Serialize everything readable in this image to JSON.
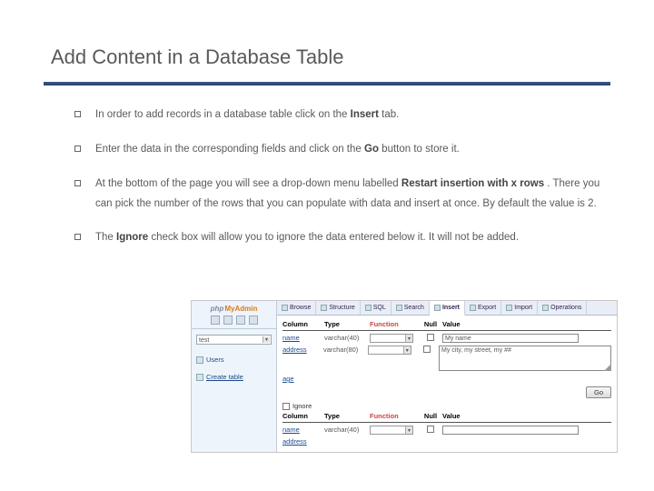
{
  "title": "Add Content in a Database Table",
  "bullets": {
    "b1_a": "In order to add records in a database table click on the ",
    "b1_s": "Insert",
    "b1_b": " tab.",
    "b2_a": "Enter the data in the corresponding fields and click on the ",
    "b2_s": "Go",
    "b2_b": " button to store it.",
    "b3_a": "At the bottom of the page you will see a drop-down menu labelled ",
    "b3_s": "Restart insertion with x rows",
    "b3_b": " . There you can pick the number of the rows that you can populate with data and insert at once. By default the value is 2.",
    "b4_a": "The ",
    "b4_s": "Ignore",
    "b4_b": " check box will allow you to ignore the data entered below it. It will not be added."
  },
  "pma": {
    "logo_php": "php",
    "logo_ma": "MyAdmin",
    "select_text": "test",
    "tree_item": "Users",
    "tree_create": "Create table",
    "tabs": {
      "browse": "Browse",
      "structure": "Structure",
      "sql": "SQL",
      "search": "Search",
      "insert": "Insert",
      "export": "Export",
      "import": "Import",
      "operations": "Operations"
    },
    "hdr": {
      "col": "Column",
      "typ": "Type",
      "fun": "Function",
      "nul": "Null",
      "val": "Value"
    },
    "rows": {
      "r1_col": "name",
      "r1_typ": "varchar(40)",
      "r1_val": "My name",
      "r2_col": "address",
      "r2_typ": "varchar(80)",
      "r2_val": "My city, my street, my ##",
      "r3_col": "age",
      "r3_typ": ""
    },
    "go": "Go",
    "ignore": "Ignore",
    "r2b_col": "name",
    "r2b_typ": "varchar(40)",
    "r2c_col": "address"
  }
}
